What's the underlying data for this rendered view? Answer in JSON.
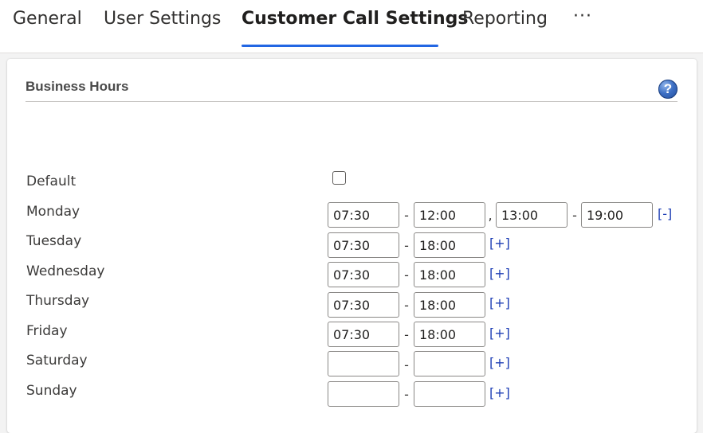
{
  "tabs": [
    {
      "label": "General"
    },
    {
      "label": "User Settings"
    },
    {
      "label": "Customer Call Settings"
    },
    {
      "label": "Reporting"
    }
  ],
  "more_label": "···",
  "section": {
    "title": "Business Hours",
    "help_label": "?"
  },
  "default_row": {
    "label": "Default",
    "checked": false
  },
  "days": [
    {
      "label": "Monday",
      "start": "07:30",
      "end": "12:00",
      "start2": "13:00",
      "end2": "19:00",
      "action": "[-]"
    },
    {
      "label": "Tuesday",
      "start": "07:30",
      "end": "18:00",
      "action": "[+]"
    },
    {
      "label": "Wednesday",
      "start": "07:30",
      "end": "18:00",
      "action": "[+]"
    },
    {
      "label": "Thursday",
      "start": "07:30",
      "end": "18:00",
      "action": "[+]"
    },
    {
      "label": "Friday",
      "start": "07:30",
      "end": "18:00",
      "action": "[+]"
    },
    {
      "label": "Saturday",
      "start": "",
      "end": "",
      "action": "[+]"
    },
    {
      "label": "Sunday",
      "start": "",
      "end": "",
      "action": "[+]"
    }
  ],
  "range_separator": "-",
  "period_separator": ",",
  "accent_color": "#2266e3",
  "link_color": "#1f3fb5"
}
